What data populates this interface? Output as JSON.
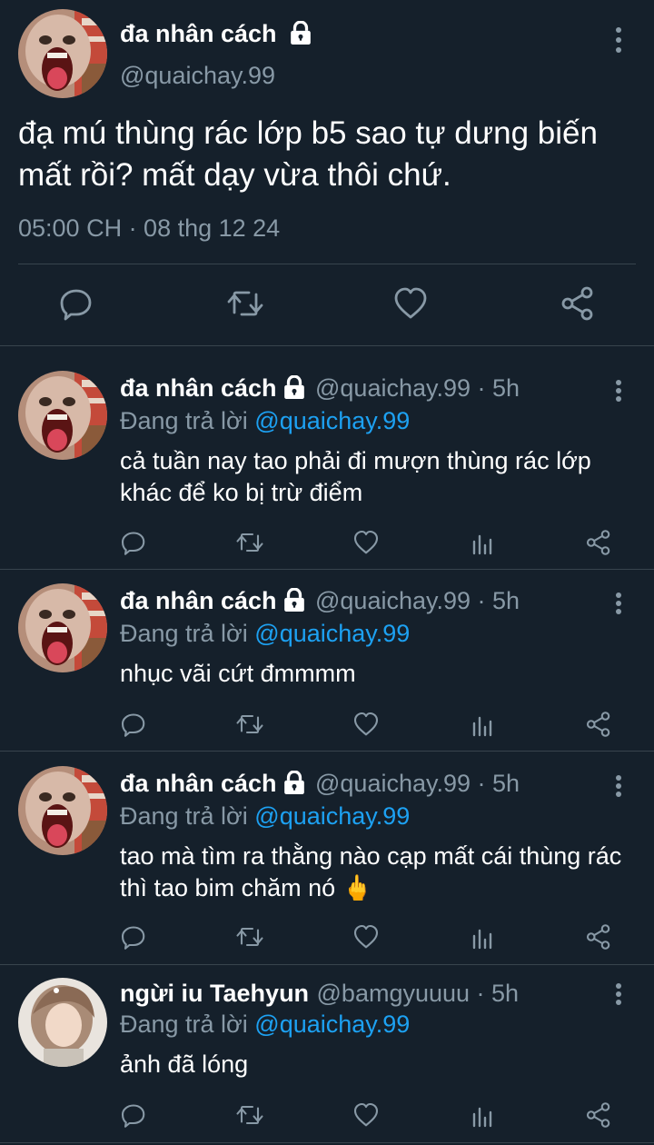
{
  "main_tweet": {
    "author_name": "đa nhân cách",
    "handle": "@quaichay.99",
    "text": "đạ mú thùng rác lớp b5 sao tự dưng biến mất rồi? mất dạy vừa thôi chứ.",
    "timestamp": "05:00 CH · 08 thg 12 24"
  },
  "replies": [
    {
      "author_name": "đa nhân cách",
      "handle_time": "@quaichay.99 · 5h",
      "replying_label": "Đang trả lời",
      "replying_to": "@quaichay.99",
      "text": "cả tuần nay tao phải đi mượn thùng rác lớp khác để ko bị trừ điểm"
    },
    {
      "author_name": "đa nhân cách",
      "handle_time": "@quaichay.99 · 5h",
      "replying_label": "Đang trả lời",
      "replying_to": "@quaichay.99",
      "text": "nhục vãi cứt đmmmm"
    },
    {
      "author_name": "đa nhân cách",
      "handle_time": "@quaichay.99 · 5h",
      "replying_label": "Đang trả lời",
      "replying_to": "@quaichay.99",
      "text": "tao mà tìm ra thằng nào cạp mất cái thùng rác thì tao bim chăm nó 🖕"
    },
    {
      "author_name": "ngừi iu Taehyun",
      "handle_time": "@bamgyuuuu · 5h",
      "replying_label": "Đang trả lời",
      "replying_to": "@quaichay.99",
      "text": "ảnh đã lóng"
    }
  ],
  "icons": {
    "verified_lock": "lock-icon",
    "actions": [
      "reply-icon",
      "retweet-icon",
      "like-icon",
      "analytics-icon",
      "share-icon"
    ],
    "more": "more-vertical-icon"
  },
  "colors": {
    "background": "#15202b",
    "text_primary": "#ffffff",
    "text_secondary": "#8899a6",
    "accent": "#1da1f2",
    "divider": "#38444d"
  }
}
